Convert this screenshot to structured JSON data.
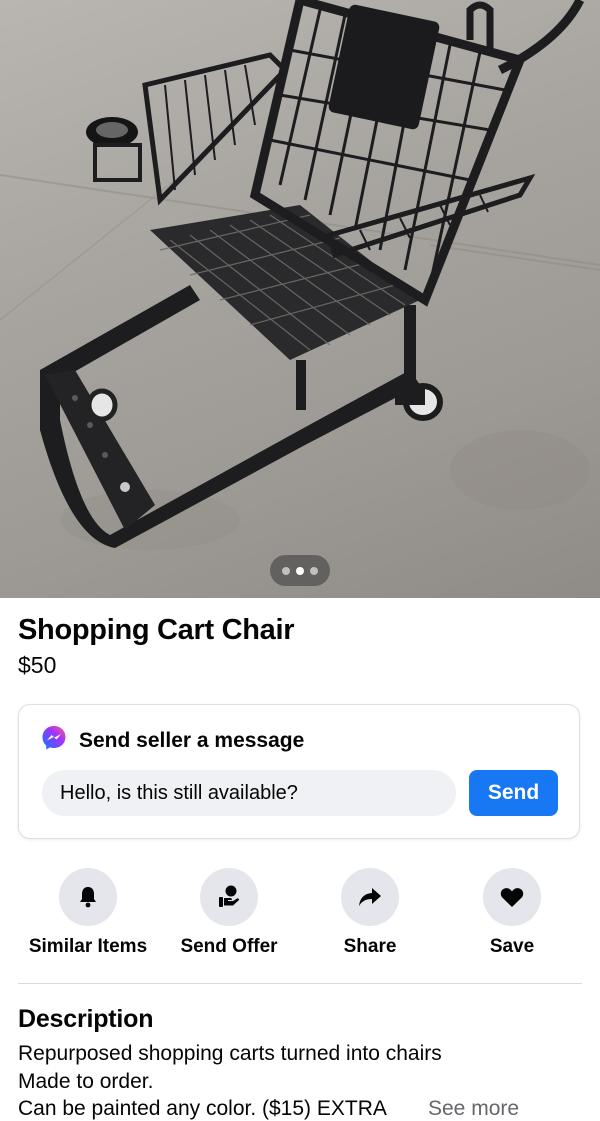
{
  "listing": {
    "title": "Shopping Cart Chair",
    "price": "$50",
    "photo": {
      "icon": "shopping-cart-chair-photo",
      "page_count": 3,
      "active_index": 1
    }
  },
  "message": {
    "header": "Send seller a message",
    "input_value": "Hello, is this still available?",
    "send_label": "Send",
    "icon": "messenger-icon",
    "accent_color": "#1877f2"
  },
  "actions": [
    {
      "label": "Similar Items",
      "icon": "bell-icon"
    },
    {
      "label": "Send Offer",
      "icon": "offer-hand-icon"
    },
    {
      "label": "Share",
      "icon": "share-arrow-icon"
    },
    {
      "label": "Save",
      "icon": "heart-icon"
    }
  ],
  "description": {
    "title": "Description",
    "lines": [
      "Repurposed shopping carts turned into chairs",
      "Made to order.",
      "Can be painted any color. ($15) EXTRA"
    ],
    "see_more": "See more"
  }
}
